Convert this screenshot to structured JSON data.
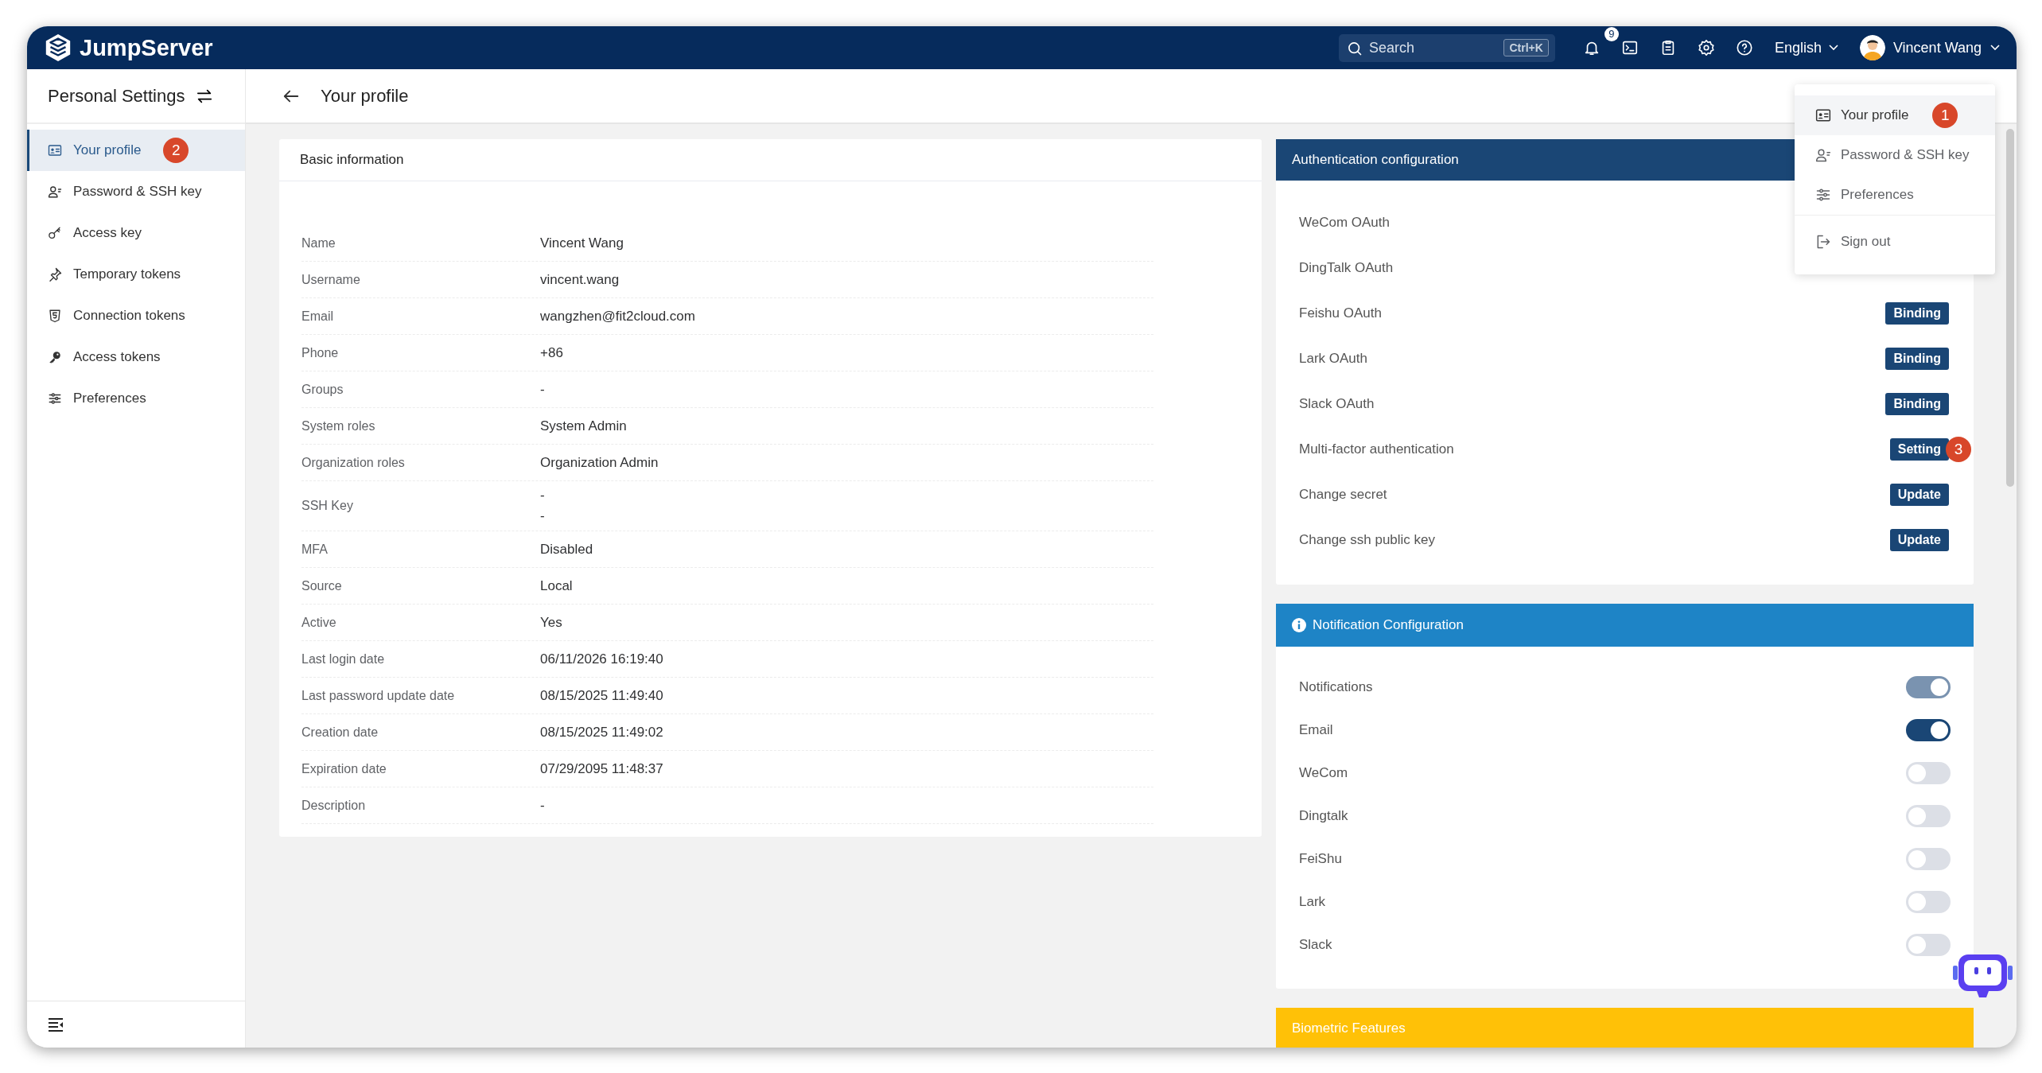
{
  "topbar": {
    "brand": "JumpServer",
    "search": {
      "placeholder": "Search",
      "shortcut": "Ctrl+K"
    },
    "notification_count": "9",
    "language": "English",
    "user": "Vincent Wang"
  },
  "sidebar": {
    "title": "Personal Settings",
    "items": [
      {
        "label": "Your profile",
        "selected": true,
        "marker": "2"
      },
      {
        "label": "Password & SSH key",
        "selected": false
      },
      {
        "label": "Access key",
        "selected": false
      },
      {
        "label": "Temporary tokens",
        "selected": false
      },
      {
        "label": "Connection tokens",
        "selected": false
      },
      {
        "label": "Access tokens",
        "selected": false
      },
      {
        "label": "Preferences",
        "selected": false
      }
    ]
  },
  "page": {
    "title": "Your profile"
  },
  "basic_info": {
    "title": "Basic information",
    "rows": [
      {
        "label": "Name",
        "value": "Vincent Wang"
      },
      {
        "label": "Username",
        "value": "vincent.wang"
      },
      {
        "label": "Email",
        "value": "wangzhen@fit2cloud.com"
      },
      {
        "label": "Phone",
        "value": "+86"
      },
      {
        "label": "Groups",
        "value": "-"
      },
      {
        "label": "System roles",
        "value": "System Admin"
      },
      {
        "label": "Organization roles",
        "value": "Organization Admin"
      },
      {
        "label": "SSH Key",
        "lines": [
          "-",
          "-"
        ]
      },
      {
        "label": "MFA",
        "value": "Disabled"
      },
      {
        "label": "Source",
        "value": "Local"
      },
      {
        "label": "Active",
        "value": "Yes"
      },
      {
        "label": "Last login date",
        "value": "06/11/2026 16:19:40"
      },
      {
        "label": "Last password update date",
        "value": "08/15/2025 11:49:40"
      },
      {
        "label": "Creation date",
        "value": "08/15/2025 11:49:02"
      },
      {
        "label": "Expiration date",
        "value": "07/29/2095 11:48:37"
      },
      {
        "label": "Description",
        "value": "-"
      }
    ]
  },
  "auth_config": {
    "title": "Authentication configuration",
    "rows": [
      {
        "label": "WeCom OAuth"
      },
      {
        "label": "DingTalk OAuth"
      },
      {
        "label": "Feishu OAuth",
        "button": "Binding"
      },
      {
        "label": "Lark OAuth",
        "button": "Binding"
      },
      {
        "label": "Slack OAuth",
        "button": "Binding"
      },
      {
        "label": "Multi-factor authentication",
        "button": "Setting",
        "marker": "3"
      },
      {
        "label": "Change secret",
        "button": "Update"
      },
      {
        "label": "Change ssh public key",
        "button": "Update"
      }
    ]
  },
  "notification_config": {
    "title": "Notification Configuration",
    "rows": [
      {
        "label": "Notifications",
        "on": true,
        "disabled": true
      },
      {
        "label": "Email",
        "on": true,
        "disabled": false
      },
      {
        "label": "WeCom",
        "on": false,
        "disabled": false
      },
      {
        "label": "Dingtalk",
        "on": false,
        "disabled": false
      },
      {
        "label": "FeiShu",
        "on": false,
        "disabled": false
      },
      {
        "label": "Lark",
        "on": false,
        "disabled": false
      },
      {
        "label": "Slack",
        "on": false,
        "disabled": false
      }
    ]
  },
  "biometric": {
    "title": "Biometric Features"
  },
  "user_menu": {
    "items": [
      {
        "label": "Your profile",
        "selected": true,
        "marker": "1"
      },
      {
        "label": "Password & SSH key",
        "selected": false
      },
      {
        "label": "Preferences",
        "selected": false
      },
      {
        "label": "Sign out",
        "selected": false
      }
    ]
  }
}
